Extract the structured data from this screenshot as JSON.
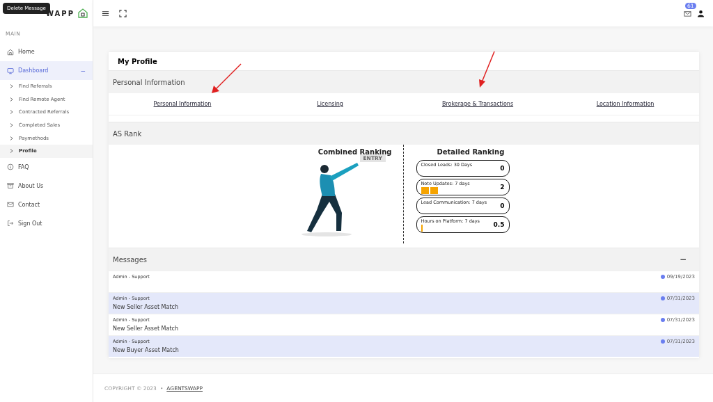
{
  "tooltip": "Delete Message",
  "logo": {
    "text": "WAPP"
  },
  "topbar": {
    "badge": "61"
  },
  "sidebar": {
    "heading": "MAIN",
    "items": [
      {
        "label": "Home",
        "selected": false
      },
      {
        "label": "Dashboard",
        "selected": true,
        "expanded": true,
        "toggle": "−",
        "children": [
          {
            "label": "Find Referrals",
            "selected": false
          },
          {
            "label": "Find Remote Agent",
            "selected": false
          },
          {
            "label": "Contracted Referrals",
            "selected": false
          },
          {
            "label": "Completed Sales",
            "selected": false
          },
          {
            "label": "Paymethods",
            "selected": false
          },
          {
            "label": "Profile",
            "selected": true
          }
        ]
      },
      {
        "label": "FAQ",
        "selected": false
      },
      {
        "label": "About Us",
        "selected": false
      },
      {
        "label": "Contact",
        "selected": false
      },
      {
        "label": "Sign Out",
        "selected": false
      }
    ]
  },
  "card": {
    "title": "My Profile",
    "personal": {
      "heading": "Personal Information",
      "links": [
        "Personal Information",
        "Licensing",
        "Brokerage & Transactions",
        "Location Information"
      ]
    },
    "rank": {
      "heading": "AS Rank",
      "combined_title": "Combined Ranking",
      "badge": "ENTRY",
      "detailed_title": "Detailed Ranking",
      "metrics": [
        {
          "label": "Closed Leads: 30 Days",
          "value": "0"
        },
        {
          "label": "Note Updates: 7 days",
          "value": "2"
        },
        {
          "label": "Lead Communication: 7 days",
          "value": "0"
        },
        {
          "label": "Hours on Platform: 7 days",
          "value": "0.5"
        }
      ]
    },
    "messages": {
      "heading": "Messages",
      "collapse": "−",
      "rows": [
        {
          "sender": "Admin - Support",
          "date": "09/19/2023",
          "highlighted": false
        },
        {
          "sender": "Admin - Support",
          "subject": "New Seller Asset Match",
          "date": "07/31/2023",
          "highlighted": true
        },
        {
          "sender": "Admin - Support",
          "subject": "New Seller Asset Match",
          "date": "07/31/2023",
          "highlighted": false
        },
        {
          "sender": "Admin - Support",
          "subject": "New Buyer Asset Match",
          "date": "07/31/2023",
          "highlighted": true
        }
      ]
    }
  },
  "footer": {
    "copyright": "COPYRIGHT © 2023",
    "dot": "•",
    "link": "AGENTSWAPP"
  }
}
